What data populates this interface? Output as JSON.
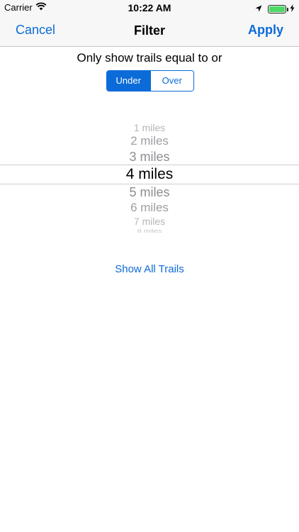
{
  "status_bar": {
    "carrier": "Carrier",
    "time": "10:22 AM",
    "icons": [
      "wifi-icon",
      "location-arrow-icon",
      "battery-icon",
      "charging-bolt-icon"
    ]
  },
  "nav": {
    "cancel_label": "Cancel",
    "title": "Filter",
    "apply_label": "Apply"
  },
  "filter": {
    "prompt": "Only show trails equal to or",
    "segments": [
      {
        "label": "Under",
        "selected": true
      },
      {
        "label": "Over",
        "selected": false
      }
    ]
  },
  "picker": {
    "items": [
      "1 miles",
      "2 miles",
      "3 miles",
      "4 miles",
      "5 miles",
      "6 miles",
      "7 miles",
      "8 miles"
    ],
    "selected": "4 miles"
  },
  "show_all_label": "Show All Trails",
  "colors": {
    "accent": "#0b6bd8",
    "bar_background": "#f7f7f7",
    "picker_inactive": "#8e8e93",
    "battery": "#4cd964"
  }
}
